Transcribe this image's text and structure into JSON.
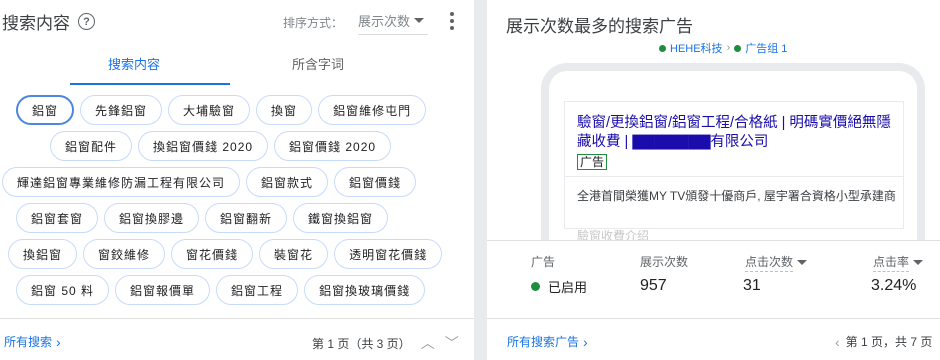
{
  "left": {
    "title": "搜索内容",
    "help_glyph": "?",
    "sort_label": "排序方式：",
    "sort_value": "展示次数",
    "tabs": [
      "搜索内容",
      "所含字词"
    ],
    "chip_rows": [
      [
        "鋁窗",
        "先鋒鋁窗",
        "大埔驗窗",
        "換窗",
        "鋁窗維修屯門"
      ],
      [
        "鋁窗配件",
        "換鋁窗價錢 2020",
        "鋁窗價錢 2020"
      ],
      [
        "輝達鋁窗專業維修防漏工程有限公司",
        "鋁窗款式",
        "鋁窗價錢"
      ],
      [
        "鋁窗套窗",
        "鋁窗換膠邊",
        "鋁窗翻新",
        "鐵窗換鋁窗"
      ],
      [
        "換鋁窗",
        "窗鉸維修",
        "窗花價錢",
        "裝窗花",
        "透明窗花價錢"
      ],
      [
        "鋁窗 50 料",
        "鋁窗報價單",
        "鋁窗工程",
        "鋁窗換玻璃價錢"
      ]
    ],
    "footer_link": "所有搜索",
    "pager": "第 1 页（共 3 页）"
  },
  "right": {
    "title": "展示次数最多的搜索广告",
    "breadcrumb": {
      "campaign": "HEHE科技",
      "sep": "›",
      "ad_group": "广告组 1"
    },
    "ad": {
      "headline": "驗窗/更換鋁窗/鋁窗工程/合格紙 | 明碼實價絕無隱藏收費 | ▇▇▇▇▇▇▇有限公司",
      "label": "广告",
      "description": "全港首間榮獲MY TV頒發十優商戶, 屋宇署合資格小型承建商",
      "sitelink": "驗窗收費介绍"
    },
    "stats": {
      "headers": {
        "ad": "广告",
        "impressions": "展示次数",
        "clicks": "点击次数",
        "ctr": "点击率"
      },
      "status": "已启用",
      "impressions": "957",
      "clicks": "31",
      "ctr": "3.24%"
    },
    "footer_link": "所有搜索广告",
    "pager": "第 1 页，共 7 页"
  },
  "colors": {
    "accent": "#1a73e8",
    "enabled": "#1e8e3e",
    "chip_border": "#c6dafc"
  }
}
